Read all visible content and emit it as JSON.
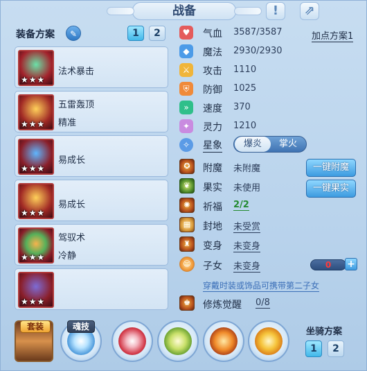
{
  "header": {
    "title": "战备"
  },
  "left": {
    "plan_label": "装备方案",
    "plan_buttons": [
      "1",
      "2"
    ],
    "equipment": [
      {
        "name": "法术暴击",
        "sub": "",
        "stars": "★★★"
      },
      {
        "name": "五雷轰顶",
        "sub": "精准",
        "stars": "★★★"
      },
      {
        "name": "易成长",
        "sub": "",
        "stars": "★★★"
      },
      {
        "name": "易成长",
        "sub": "",
        "stars": "★★★"
      },
      {
        "name": "驾驭术",
        "sub": "冷静",
        "stars": "★★★"
      },
      {
        "name": "",
        "sub": "",
        "stars": "★★★"
      }
    ]
  },
  "stats": {
    "add_plan": "加点方案1",
    "rows": [
      {
        "label": "气血",
        "value": "3587/3587",
        "color": "#e45b5b"
      },
      {
        "label": "魔法",
        "value": "2930/2930",
        "color": "#4c9be8"
      },
      {
        "label": "攻击",
        "value": "1110",
        "color": "#f0b53a"
      },
      {
        "label": "防御",
        "value": "1025",
        "color": "#f08a3a"
      },
      {
        "label": "速度",
        "value": "370",
        "color": "#2fbf8a"
      },
      {
        "label": "灵力",
        "value": "1210",
        "color": "#c98be0"
      }
    ],
    "star_label": "星象",
    "star_options": [
      "爆炎",
      "掌火"
    ]
  },
  "functions": {
    "rows": [
      {
        "label": "附魔",
        "value": "未附魔"
      },
      {
        "label": "果实",
        "value": "未使用"
      },
      {
        "label": "祈福",
        "value": "2/2"
      },
      {
        "label": "封地",
        "value": "未受赏"
      },
      {
        "label": "变身",
        "value": "未变身"
      },
      {
        "label": "子女",
        "value": "未变身"
      },
      {
        "label": "修炼觉醒",
        "value": "0/8"
      }
    ],
    "enchant_button": "一键附魔",
    "fruit_button": "一键果实",
    "child_counter": "0",
    "plus_label": "+",
    "hint": "穿戴时装或饰品可携带第二子女"
  },
  "bottom": {
    "suit_label": "套装",
    "soul_label": "魂技",
    "mount_label": "坐骑方案",
    "mount_buttons": [
      "1",
      "2"
    ]
  }
}
